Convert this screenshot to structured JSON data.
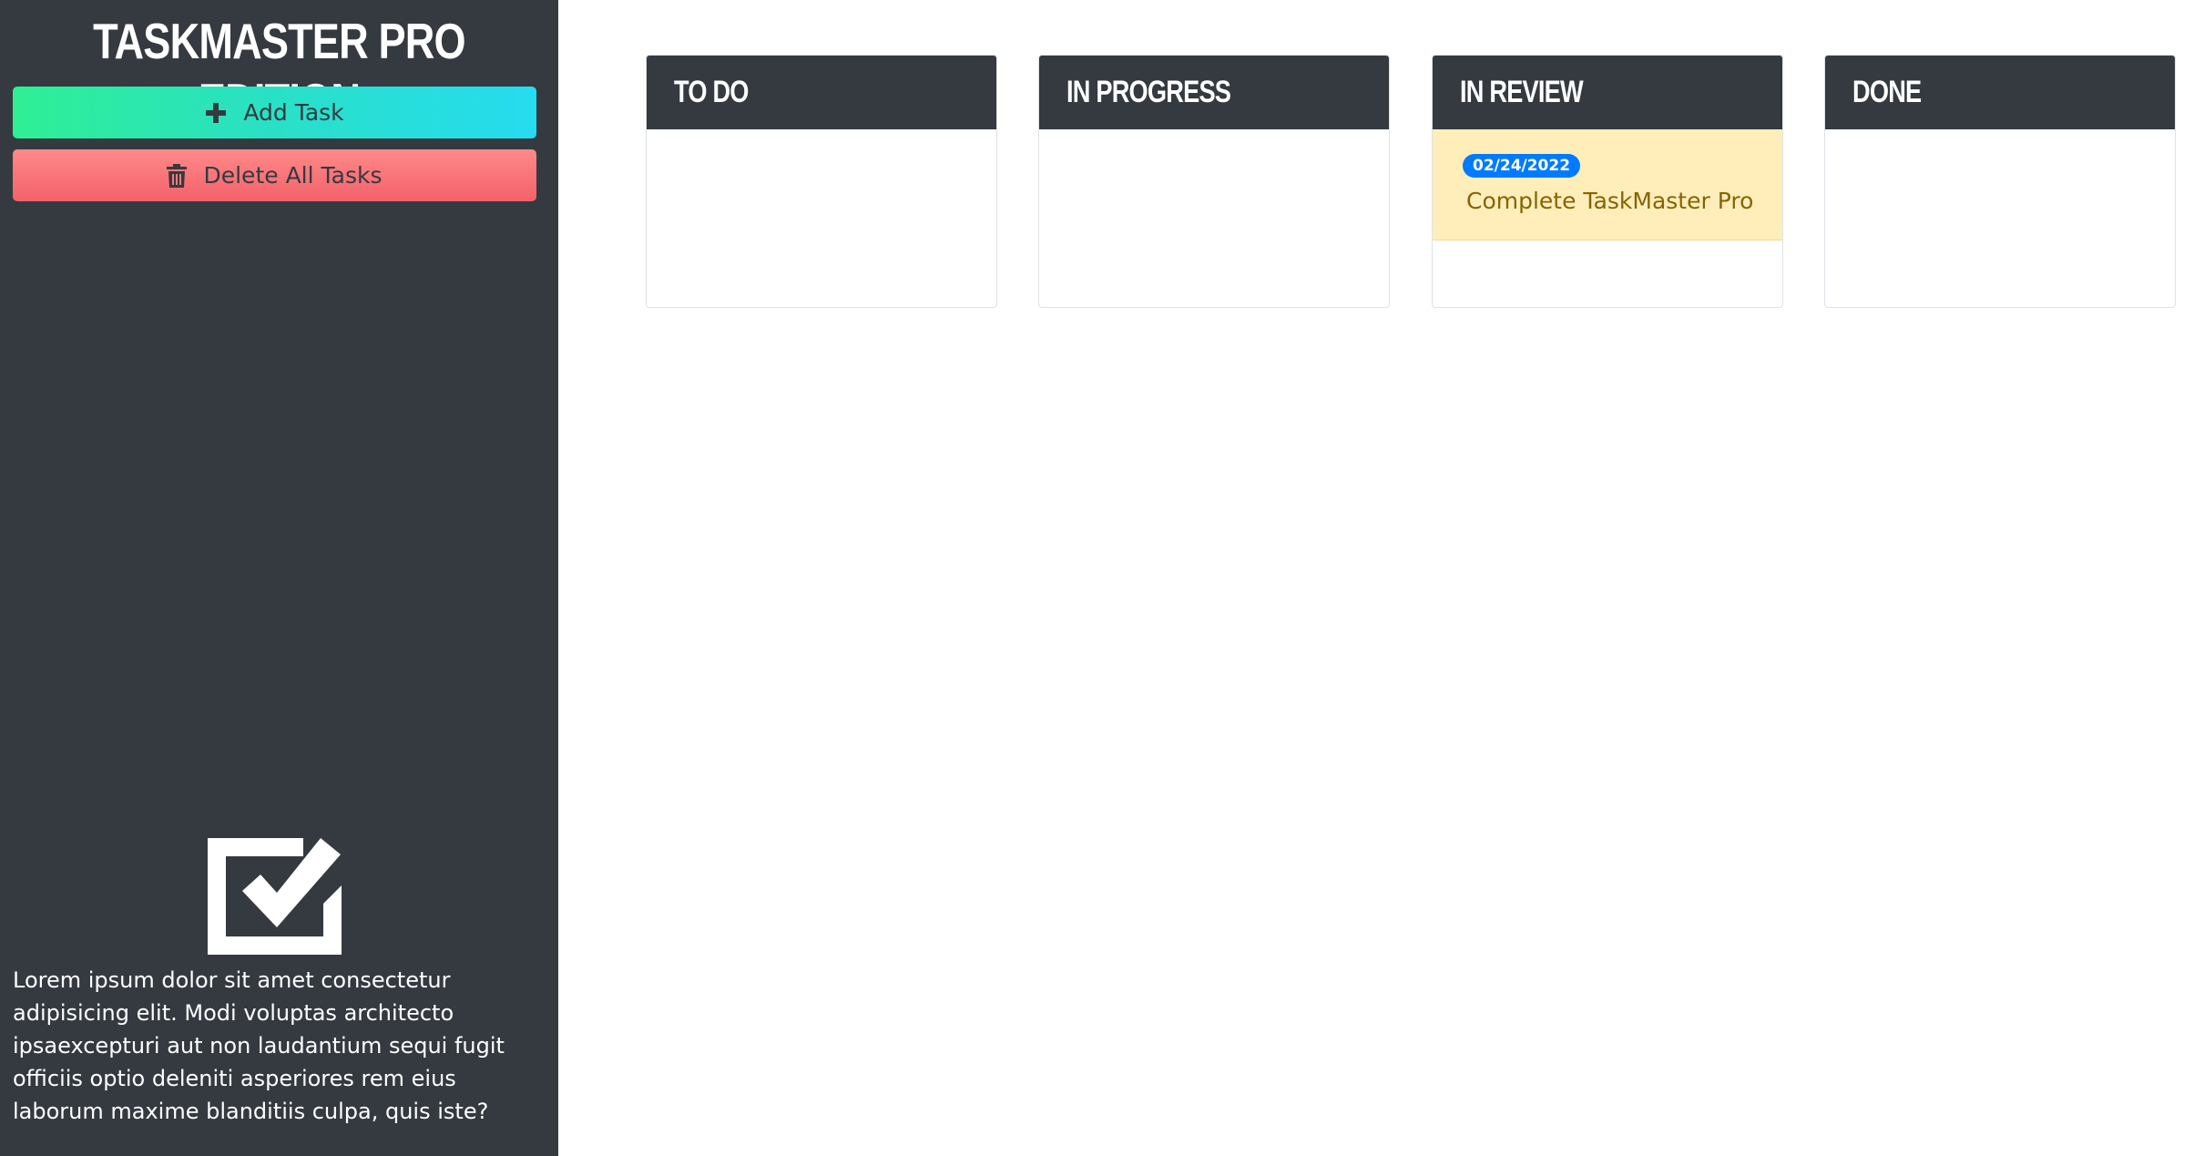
{
  "app": {
    "title": "TASKMASTER PRO EDITION"
  },
  "sidebar": {
    "add_task_label": "Add Task",
    "add_task_icon": "plus-icon",
    "delete_all_label": "Delete All Tasks",
    "delete_all_icon": "trash-icon",
    "logo_icon": "checkbox-checked-icon",
    "about_text": "Lorem ipsum dolor sit amet consectetur adipisicing elit. Modi voluptas architecto ipsaexcepturi aut non laudantium sequi fugit officiis optio deleniti asperiores rem eius laborum maxime blanditiis culpa, quis iste?"
  },
  "board": {
    "columns": [
      {
        "title": "TO DO",
        "tasks": []
      },
      {
        "title": "IN PROGRESS",
        "tasks": []
      },
      {
        "title": "IN REVIEW",
        "tasks": [
          {
            "date": "02/24/2022",
            "title": "Complete TaskMaster Pro"
          }
        ]
      },
      {
        "title": "DONE",
        "tasks": []
      }
    ]
  },
  "colors": {
    "sidebar_bg": "#343a40",
    "add_gradient_start": "#2fef94",
    "add_gradient_end": "#26dcf0",
    "delete_bg": "#f3616a",
    "card_bg": "#ffeeba",
    "card_text": "#856404",
    "date_badge": "#007bff"
  }
}
